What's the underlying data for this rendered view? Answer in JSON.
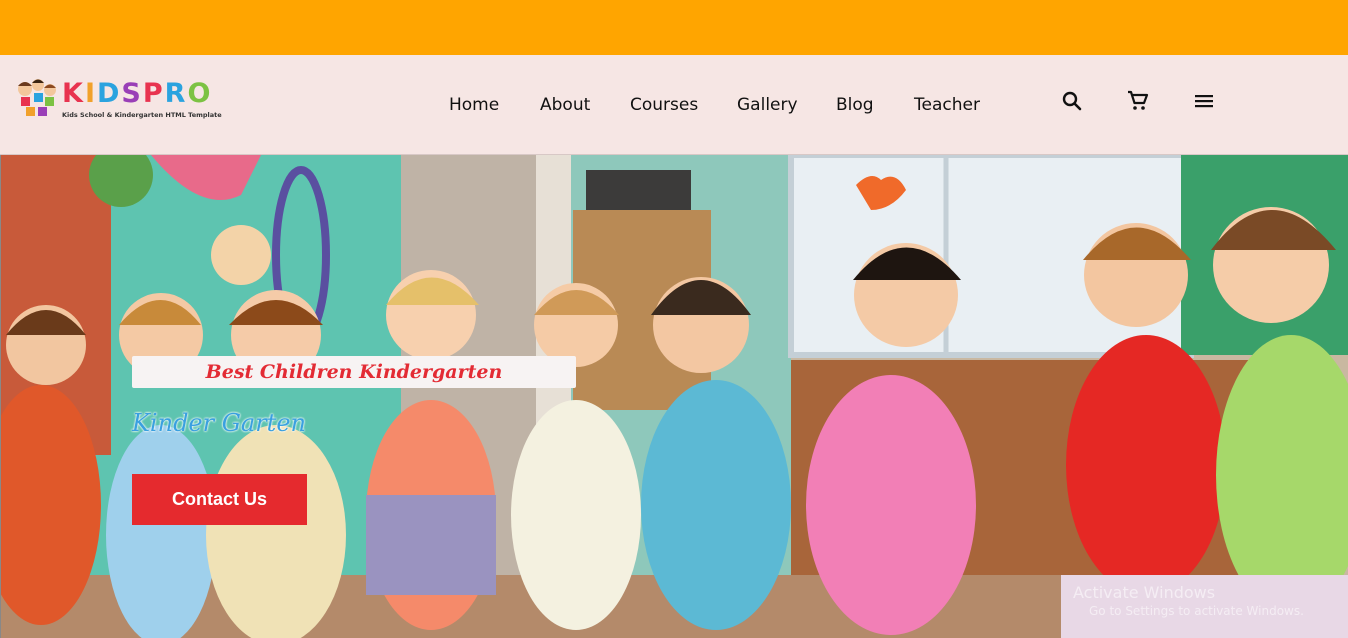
{
  "colors": {
    "topbar": "#ffa500",
    "header_bg": "#f6e6e4",
    "accent_red": "#e52a2e",
    "subtitle_blue": "#3aa0e0"
  },
  "logo": {
    "letters": [
      "K",
      "I",
      "D",
      "S",
      "P",
      "R",
      "O"
    ],
    "letter_colors": [
      "#e8334f",
      "#f1a12b",
      "#2ba3df",
      "#9a3fb7",
      "#e8334f",
      "#2ba3df",
      "#7cc243"
    ],
    "tagline": "Kids School & Kindergarten HTML Template"
  },
  "nav": {
    "items": [
      {
        "label": "Home"
      },
      {
        "label": "About"
      },
      {
        "label": "Courses"
      },
      {
        "label": "Gallery"
      },
      {
        "label": "Blog"
      },
      {
        "label": "Teacher"
      }
    ]
  },
  "header_icons": {
    "search": "search-icon",
    "cart": "cart-icon",
    "menu": "menu-icon"
  },
  "hero": {
    "title": "Best Children Kindergarten",
    "subtitle": "Kinder Garten",
    "cta_label": "Contact Us"
  },
  "watermark": {
    "line1": "Activate Windows",
    "line2": "Go to Settings to activate Windows."
  }
}
